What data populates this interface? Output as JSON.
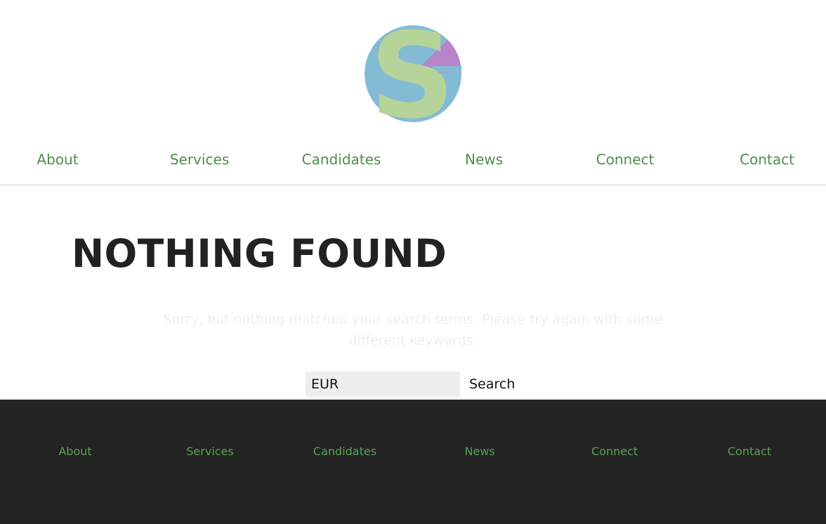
{
  "header": {
    "logo_icon": "sg-circle-logo",
    "nav": [
      {
        "label": "About"
      },
      {
        "label": "Services"
      },
      {
        "label": "Candidates"
      },
      {
        "label": "News"
      },
      {
        "label": "Connect"
      },
      {
        "label": "Contact"
      }
    ]
  },
  "main": {
    "title": "NOTHING FOUND",
    "message": "Sorry, but nothing matched your search terms. Please try again with some different keywords.",
    "search": {
      "value": "EUR",
      "button_label": "Search"
    }
  },
  "footer": {
    "nav": [
      {
        "label": "About"
      },
      {
        "label": "Services"
      },
      {
        "label": "Candidates"
      },
      {
        "label": "News"
      },
      {
        "label": "Connect"
      },
      {
        "label": "Contact"
      }
    ]
  },
  "colors": {
    "nav_link": "#4f8e4a",
    "footer_link": "#5aa055",
    "footer_bg": "#232323",
    "logo_blue": "#84bbd4",
    "logo_green": "#b6d39a",
    "logo_purple": "#b784cc"
  }
}
